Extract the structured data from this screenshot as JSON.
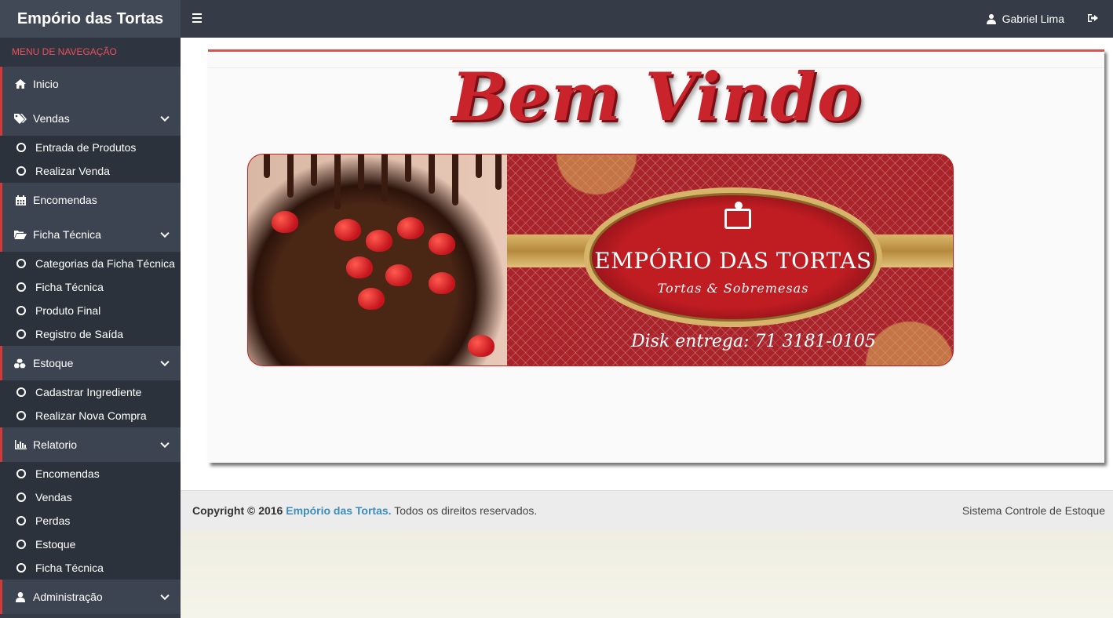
{
  "app": {
    "title": "Empório das Tortas"
  },
  "sidebar": {
    "header": "MENU DE NAVEGAÇÃO",
    "items": [
      {
        "label": "Inicio",
        "icon": "home-icon",
        "submenu": []
      },
      {
        "label": "Vendas",
        "icon": "tags-icon",
        "submenu": [
          "Entrada de Produtos",
          "Realizar Venda"
        ]
      },
      {
        "label": "Encomendas",
        "icon": "calendar-icon",
        "submenu": []
      },
      {
        "label": "Ficha Técnica",
        "icon": "folder-open-icon",
        "submenu": [
          "Categorias da Ficha Técnica",
          "Ficha Técnica",
          "Produto Final",
          "Registro de Saída"
        ]
      },
      {
        "label": "Estoque",
        "icon": "cubes-icon",
        "submenu": [
          "Cadastrar Ingrediente",
          "Realizar Nova Compra"
        ]
      },
      {
        "label": "Relatorio",
        "icon": "bar-chart-icon",
        "submenu": [
          "Encomendas",
          "Vendas",
          "Perdas",
          "Estoque",
          "Ficha Técnica"
        ]
      },
      {
        "label": "Administração",
        "icon": "user-icon",
        "submenu": []
      }
    ]
  },
  "topbar": {
    "user_name": "Gabriel Lima"
  },
  "main": {
    "welcome": "Bem Vindo",
    "banner": {
      "brand": "EMPÓRIO DAS TORTAS",
      "subtitle": "Tortas & Sobremesas",
      "phone": "Disk entrega: 71 3181-0105"
    }
  },
  "footer": {
    "copyright_prefix": "Copyright © 2016",
    "brand": "Empório das Tortas.",
    "rights": "Todos os direitos reservados.",
    "system": "Sistema Controle de Estoque"
  },
  "colors": {
    "accent": "#d23a3a",
    "sidebar": "#353c48",
    "link": "#3c8dbc",
    "welcome": "#c9232b"
  }
}
